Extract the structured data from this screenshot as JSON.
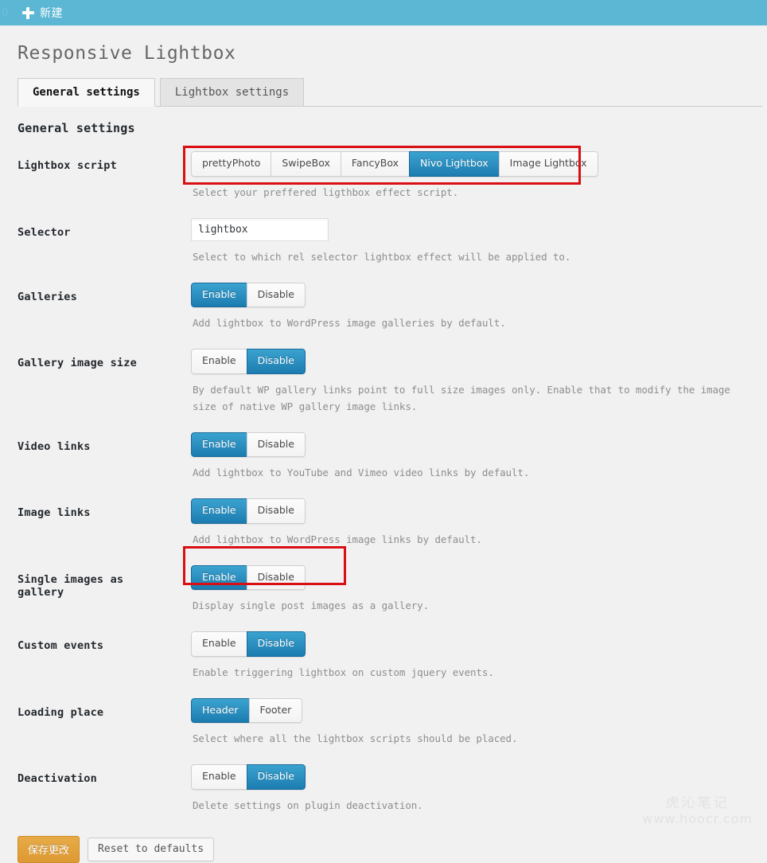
{
  "adminbar": {
    "left_stub": "0",
    "new_icon": "plus-icon",
    "new_label": "新建"
  },
  "page": {
    "title": "Responsive Lightbox",
    "section_heading": "General settings"
  },
  "tabs": [
    {
      "label": "General settings",
      "active": true
    },
    {
      "label": "Lightbox settings",
      "active": false
    }
  ],
  "colors": {
    "adminbar_bg": "#5bb7d4",
    "active_button": "#1c7cb0",
    "annotation": "#d90f14",
    "primary_button": "#dd9933"
  },
  "fields": {
    "lightbox_script": {
      "label": "Lightbox script",
      "options": [
        "prettyPhoto",
        "SwipeBox",
        "FancyBox",
        "Nivo Lightbox",
        "Image Lightbox"
      ],
      "selected": "Nivo Lightbox",
      "description": "Select your preffered ligthbox effect script."
    },
    "selector": {
      "label": "Selector",
      "value": "lightbox",
      "placeholder": "",
      "description": "Select to which rel selector lightbox effect will be applied to."
    },
    "galleries": {
      "label": "Galleries",
      "options": [
        "Enable",
        "Disable"
      ],
      "selected": "Enable",
      "description": "Add lightbox to WordPress image galleries by default."
    },
    "gallery_image_size": {
      "label": "Gallery image size",
      "options": [
        "Enable",
        "Disable"
      ],
      "selected": "Disable",
      "description": "By default WP gallery links point to full size images only. Enable that to modify the image size of native WP gallery image links."
    },
    "video_links": {
      "label": "Video links",
      "options": [
        "Enable",
        "Disable"
      ],
      "selected": "Enable",
      "description": "Add lightbox to YouTube and Vimeo video links by default."
    },
    "image_links": {
      "label": "Image links",
      "options": [
        "Enable",
        "Disable"
      ],
      "selected": "Enable",
      "description": "Add lightbox to WordPress image links by default."
    },
    "single_images_as_gallery": {
      "label": "Single images as gallery",
      "options": [
        "Enable",
        "Disable"
      ],
      "selected": "Enable",
      "description": "Display single post images as a gallery."
    },
    "custom_events": {
      "label": "Custom events",
      "options": [
        "Enable",
        "Disable"
      ],
      "selected": "Disable",
      "description": "Enable triggering lightbox on custom jquery events."
    },
    "loading_place": {
      "label": "Loading place",
      "options": [
        "Header",
        "Footer"
      ],
      "selected": "Header",
      "description": "Select where all the lightbox scripts should be placed."
    },
    "deactivation": {
      "label": "Deactivation",
      "options": [
        "Enable",
        "Disable"
      ],
      "selected": "Disable",
      "description": "Delete settings on plugin deactivation."
    }
  },
  "submit": {
    "save_label": "保存更改",
    "reset_label": "Reset to defaults"
  },
  "watermark": {
    "cn": "虎沁笔记",
    "url": "www.hoocr.com"
  }
}
